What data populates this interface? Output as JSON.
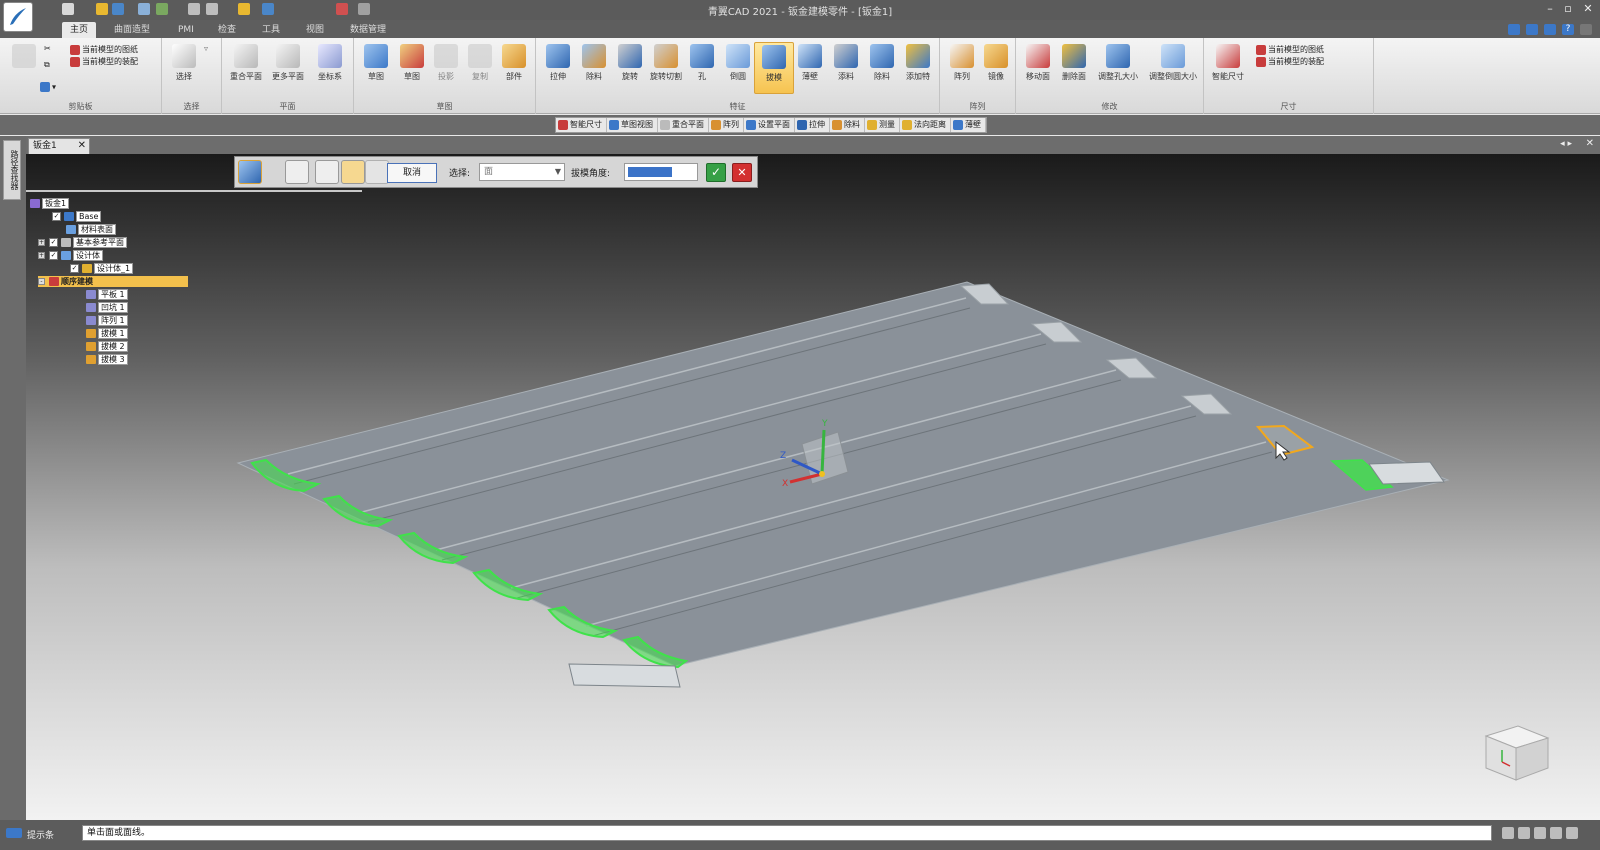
{
  "app": {
    "title": "青翼CAD 2021 - 钣金建模零件 - [钣金1]"
  },
  "ribbon_tabs": [
    {
      "label": "主页",
      "active": true
    },
    {
      "label": "曲面造型"
    },
    {
      "label": "PMI"
    },
    {
      "label": "检查"
    },
    {
      "label": "工具"
    },
    {
      "label": "视图"
    },
    {
      "label": "数据管理"
    }
  ],
  "ribbon": {
    "clipboard": {
      "label": "剪贴板",
      "item1": "当前模型的图纸",
      "item2": "当前模型的装配"
    },
    "select": {
      "label": "选择",
      "button": "选择"
    },
    "plane": {
      "label": "平面",
      "buttons": [
        "重合平面",
        "更多平面",
        "坐标系"
      ]
    },
    "sketch": {
      "label": "草图",
      "buttons": [
        "草图",
        "草图",
        "投影",
        "复制",
        "部件"
      ]
    },
    "feature": {
      "label": "特征",
      "buttons": [
        "拉伸",
        "除料",
        "旋转",
        "旋转切割",
        "孔",
        "倒圆",
        "拔模",
        "薄壁",
        "添料",
        "除料",
        "添加特"
      ]
    },
    "pattern": {
      "label": "阵列",
      "buttons": [
        "阵列",
        "镜像"
      ]
    },
    "modify": {
      "label": "修改",
      "buttons": [
        "移动面",
        "删除面",
        "调整孔大小",
        "调整倒圆大小"
      ]
    },
    "dimension": {
      "label": "尺寸",
      "button": "智能尺寸",
      "item1": "当前模型的图纸",
      "item2": "当前模型的装配"
    }
  },
  "subtoolbar": [
    "智能尺寸",
    "草图视图",
    "重合平面",
    "阵列",
    "设置平面",
    "拉伸",
    "除料",
    "测量",
    "法向距离",
    "薄壁"
  ],
  "document_tab": {
    "label": "钣金1",
    "close": "✕"
  },
  "left_panel": {
    "pin_label": "路径查找器"
  },
  "feature_dialog": {
    "cancel": "取消",
    "select_label": "选择:",
    "select_value": "面",
    "angle_label": "拔模角度:",
    "ok": "✓",
    "close": "✕"
  },
  "tree": [
    {
      "label": "钣金1",
      "indent": 0
    },
    {
      "label": "Base",
      "indent": 1,
      "checked": true
    },
    {
      "label": "材料表面",
      "indent": 2
    },
    {
      "label": "基本参考平面",
      "indent": 1,
      "checked": true,
      "expand": "+"
    },
    {
      "label": "设计体",
      "indent": 1,
      "checked": true,
      "expand": "+"
    },
    {
      "label": "设计体_1",
      "indent": 2,
      "checked": true
    },
    {
      "label": "顺序建模",
      "indent": 1,
      "expand": "-",
      "highlight": true
    },
    {
      "label": "平板 1",
      "indent": 3
    },
    {
      "label": "凹坑 1",
      "indent": 3
    },
    {
      "label": "阵列 1",
      "indent": 3
    },
    {
      "label": "拔模 1",
      "indent": 3
    },
    {
      "label": "拔模 2",
      "indent": 3
    },
    {
      "label": "拔模 3",
      "indent": 3
    }
  ],
  "status": {
    "label": "提示条",
    "message": "单击面或面线。"
  },
  "colors": {
    "accent": "#f3c04c",
    "highlight_green": "#3fe24a",
    "selection_orange": "#f2a81c",
    "ok_green": "#36a046",
    "cancel_red": "#d33030"
  },
  "icons": [
    "app-logo-icon",
    "new-icon",
    "open-icon",
    "save-icon",
    "undo-icon",
    "redo-icon",
    "help-icon",
    "triad-icon",
    "view-cube-icon"
  ]
}
